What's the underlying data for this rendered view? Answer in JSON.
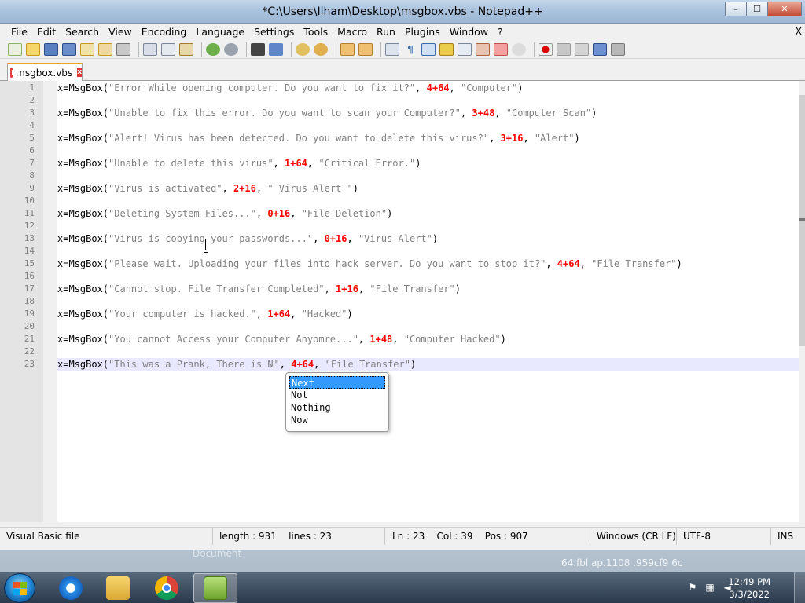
{
  "window": {
    "title": "*C:\\Users\\Ilham\\Desktop\\msgbox.vbs - Notepad++",
    "minimize": "–",
    "maximize": "☐",
    "close": "✕"
  },
  "menu": {
    "items": [
      "File",
      "Edit",
      "Search",
      "View",
      "Encoding",
      "Language",
      "Settings",
      "Tools",
      "Macro",
      "Run",
      "Plugins",
      "Window",
      "?"
    ],
    "close_glyph": "X"
  },
  "tab": {
    "label": "msgbox.vbs",
    "close_glyph": "x"
  },
  "editor": {
    "lines": [
      {
        "n": "1",
        "fn": "x=MsgBox(",
        "str": "\"Error While opening computer. Do you want to fix it?\"",
        "sep1": ", ",
        "num": "4+64",
        "sep2": ", ",
        "title": "\"Computer\"",
        "end": ")"
      },
      {
        "n": "2"
      },
      {
        "n": "3",
        "fn": "x=MsgBox(",
        "str": "\"Unable to fix this error. Do you want to scan your Computer?\"",
        "sep1": ", ",
        "num": "3+48",
        "sep2": ", ",
        "title": "\"Computer Scan\"",
        "end": ")"
      },
      {
        "n": "4"
      },
      {
        "n": "5",
        "fn": "x=MsgBox(",
        "str": "\"Alert! Virus has been detected. Do you want to delete this virus?\"",
        "sep1": ", ",
        "num": "3+16",
        "sep2": ", ",
        "title": "\"Alert\"",
        "end": ")"
      },
      {
        "n": "6"
      },
      {
        "n": "7",
        "fn": "x=MsgBox(",
        "str": "\"Unable to delete this virus\"",
        "sep1": ", ",
        "num": "1+64",
        "sep2": ", ",
        "title": "\"Critical Error.\"",
        "end": ")"
      },
      {
        "n": "8"
      },
      {
        "n": "9",
        "fn": "x=MsgBox(",
        "str": "\"Virus is activated\"",
        "sep1": ", ",
        "num": "2+16",
        "sep2": ", ",
        "title": "\" Virus Alert \"",
        "end": ")"
      },
      {
        "n": "10"
      },
      {
        "n": "11",
        "fn": "x=MsgBox(",
        "str": "\"Deleting System Files...\"",
        "sep1": ", ",
        "num": "0+16",
        "sep2": ", ",
        "title": "\"File Deletion\"",
        "end": ")"
      },
      {
        "n": "12"
      },
      {
        "n": "13",
        "fn": "x=MsgBox(",
        "str": "\"Virus is copying your passwords...\"",
        "sep1": ", ",
        "num": "0+16",
        "sep2": ", ",
        "title": "\"Virus Alert\"",
        "end": ")"
      },
      {
        "n": "14"
      },
      {
        "n": "15",
        "fn": "x=MsgBox(",
        "str": "\"Please wait. Uploading your files into hack server. Do you want to stop it?\"",
        "sep1": ", ",
        "num": "4+64",
        "sep2": ", ",
        "title": "\"File Transfer\"",
        "end": ")"
      },
      {
        "n": "16"
      },
      {
        "n": "17",
        "fn": "x=MsgBox(",
        "str": "\"Cannot stop. File Transfer Completed\"",
        "sep1": ", ",
        "num": "1+16",
        "sep2": ", ",
        "title": "\"File Transfer\"",
        "end": ")"
      },
      {
        "n": "18"
      },
      {
        "n": "19",
        "fn": "x=MsgBox(",
        "str": "\"Your computer is hacked.\"",
        "sep1": ", ",
        "num": "1+64",
        "sep2": ", ",
        "title": "\"Hacked\"",
        "end": ")"
      },
      {
        "n": "20"
      },
      {
        "n": "21",
        "fn": "x=MsgBox(",
        "str": "\"You cannot Access your Computer Anyomre...\"",
        "sep1": ", ",
        "num": "1+48",
        "sep2": ", ",
        "title": "\"Computer Hacked\"",
        "end": ")"
      },
      {
        "n": "22"
      },
      {
        "n": "23",
        "fn": "x=MsgBox(",
        "str_before_caret": "\"This was a Prank, There is N",
        "str_after_caret": "\"",
        "sep1": ", ",
        "num": "4+64",
        "sep2": ", ",
        "title": "\"File Transfer\"",
        "end": ")",
        "current": true
      }
    ]
  },
  "autocomplete": {
    "items": [
      "Next",
      "Not",
      "Nothing",
      "Now"
    ],
    "selected_index": 0
  },
  "statusbar": {
    "file_type": "Visual Basic file",
    "length": "length : 931",
    "lines": "lines : 23",
    "ln": "Ln : 23",
    "col": "Col : 39",
    "pos": "Pos : 907",
    "eol": "Windows (CR LF)",
    "encoding": "UTF-8",
    "mode": "INS"
  },
  "desktop": {
    "document_label": "Document",
    "bg_text": "64.fbl  ap.1108  .959cf9  6c"
  },
  "taskbar": {
    "time": "12:49 PM",
    "date": "3/3/2022"
  },
  "colors": {
    "number": "#ff0000",
    "string": "#808080",
    "selection": "#3399ff",
    "current_line": "#e8e8ff"
  }
}
